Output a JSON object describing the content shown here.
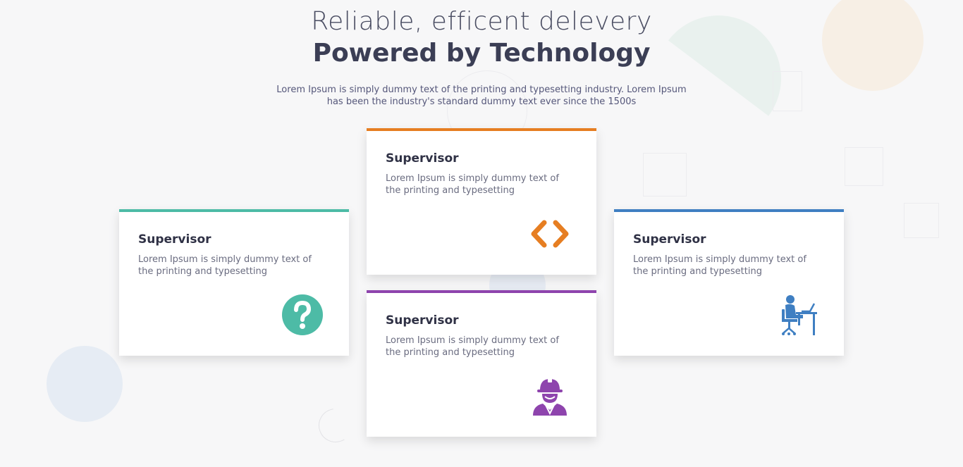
{
  "hero": {
    "title": "Reliable, efficent delevery",
    "subtitle": "Powered by Technology",
    "description": "Lorem Ipsum is simply dummy text of the printing and typesetting industry. Lorem Ipsum has been the industry's standard dummy text ever since the 1500s"
  },
  "cards": [
    {
      "title": "Supervisor",
      "text": "Lorem Ipsum is simply dummy text of the printing and typesetting",
      "icon": "code-brackets-icon",
      "color": "#e67e22"
    },
    {
      "title": "Supervisor",
      "text": "Lorem Ipsum is simply dummy text of the printing and typesetting",
      "icon": "question-circle-icon",
      "color": "#4dbba6"
    },
    {
      "title": "Supervisor",
      "text": "Lorem Ipsum is simply dummy text of the printing and typesetting",
      "icon": "worker-helmet-icon",
      "color": "#8e44ad"
    },
    {
      "title": "Supervisor",
      "text": "Lorem Ipsum is simply dummy text of the printing and typesetting",
      "icon": "person-at-desk-icon",
      "color": "#3f7fc2"
    }
  ]
}
